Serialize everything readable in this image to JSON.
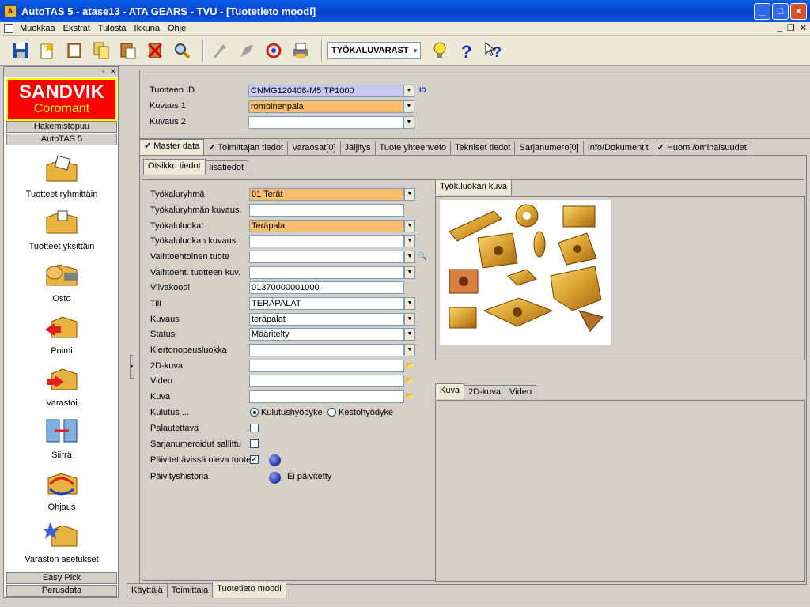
{
  "window": {
    "title": "AutoTAS 5 - atase13 - ATA GEARS - TVU - [Tuotetieto moodi]",
    "app_icon": "autotas-icon"
  },
  "menu": [
    "Muokkaa",
    "Ekstrat",
    "Tulosta",
    "Ikkuna",
    "Ohje"
  ],
  "toolbar": {
    "warehouse": "TYÖKALUVARAST"
  },
  "sidebar": {
    "logo_top": "SANDVIK",
    "logo_bottom": "Coromant",
    "section1": "Hakemistopuu",
    "section2": "AutoTAS 5",
    "items": [
      "Tuotteet ryhmittäin",
      "Tuotteet yksittäin",
      "Osto",
      "Poimi",
      "Varastoi",
      "Siirrä",
      "Ohjaus",
      "Varaston asetukset"
    ],
    "footer1": "Easy Pick",
    "footer2": "Perusdata"
  },
  "header": {
    "product_id_label": "Tuotteen ID",
    "product_id": "CNMG120408-M5 TP1000",
    "desc1_label": "Kuvaus 1",
    "desc1": "rombinenpala",
    "desc2_label": "Kuvaus 2",
    "desc2": "",
    "id_button": "ID"
  },
  "tabs": [
    {
      "label": "Master data",
      "checked": true
    },
    {
      "label": "Toimittajan tiedot",
      "checked": true
    },
    {
      "label": "Varaosat[0]",
      "checked": false
    },
    {
      "label": "Jäljitys",
      "checked": false
    },
    {
      "label": "Tuote yhteenveto",
      "checked": false
    },
    {
      "label": "Tekniset tiedot",
      "checked": false
    },
    {
      "label": "Sarjanumero[0]",
      "checked": false
    },
    {
      "label": "Info/Dokumentit",
      "checked": false
    },
    {
      "label": "Huom./ominaisuudet",
      "checked": true
    }
  ],
  "subtabs": [
    "Otsikko tiedot",
    "lisätiedot"
  ],
  "form": {
    "tool_group_label": "Työkaluryhmä",
    "tool_group": "01 Terät",
    "tool_group_desc_label": "Työkaluryhmän kuvaus.",
    "tool_group_desc": "",
    "tool_class_label": "Työkaluluokat",
    "tool_class": "Teräpala",
    "tool_class_desc_label": "Työkaluluokan kuvaus.",
    "tool_class_desc": "",
    "alt_product_label": "Vaihtoehtoinen tuote",
    "alt_product": "",
    "alt_product_desc_label": "Vaihtoeht. tuotteen kuv.",
    "alt_product_desc": "",
    "barcode_label": "Viivakoodi",
    "barcode": "01370000001000",
    "account_label": "Tili",
    "account": "TERÄPALAT",
    "desc_label": "Kuvaus",
    "desc": "teräpalat",
    "status_label": "Status",
    "status": "Määritelty",
    "turnover_label": "Kiertonopeusluokka",
    "turnover": "",
    "image2d_label": "2D-kuva",
    "image2d": "",
    "video_label": "Video",
    "video": "",
    "image_label": "Kuva",
    "image": "",
    "consumption_label": "Kulutus ...",
    "consumption_opt1": "Kulutushyödyke",
    "consumption_opt2": "Kestohyödyke",
    "consumption_selected": 1,
    "returnable_label": "Palautettava",
    "returnable": false,
    "serial_allowed_label": "Sarjanumeroidut sallittu",
    "serial_allowed": false,
    "updatable_label": "Päivitettävissä oleva tuote",
    "updatable": true,
    "update_history_label": "Päivityshistoria",
    "update_history": "Ei päivitetty"
  },
  "image_panel1_tab": "Työk.luokan kuva",
  "image_panel2_tabs": [
    "Kuva",
    "2D-kuva",
    "Video"
  ],
  "bottom_tabs": [
    "Käyttäjä",
    "Toimittaja",
    "Tuotetieto moodi"
  ]
}
